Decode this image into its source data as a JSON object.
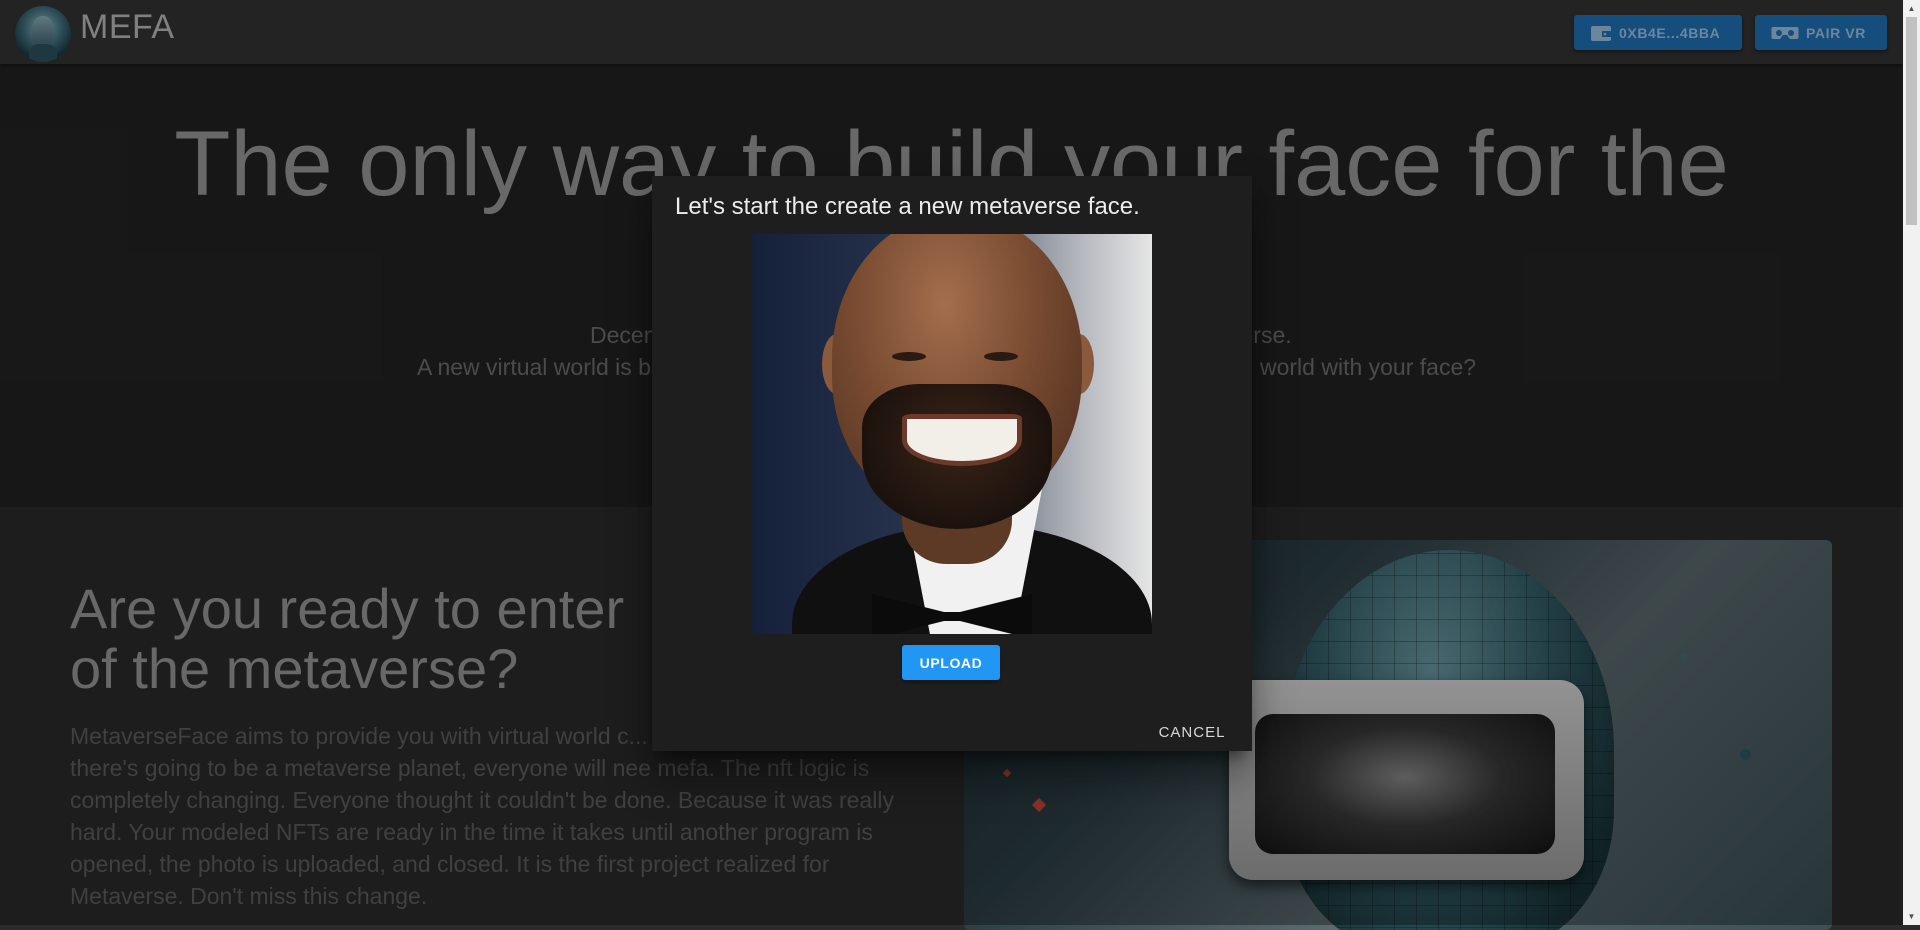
{
  "header": {
    "brand": "MEFA",
    "wallet_button": "0XB4E...4BBA",
    "pair_vr_button": "PAIR VR"
  },
  "hero": {
    "title": "The only way to build your face for the",
    "subtitle_line1_left": "Decen",
    "subtitle_line1_right": "verse.",
    "subtitle_line2_left": "A new virtual world is b",
    "subtitle_line2_right": "world with your face?"
  },
  "section": {
    "title_line1": "Are you ready to enter",
    "title_line2": "of the metaverse?",
    "paragraph": "MetaverseFace aims to provide you with virtual world c... with different features. If there's going to be a metaverse planet, everyone will nee mefa. The nft logic is completely changing. Everyone thought it couldn't be done. Because it was really hard. Your modeled NFTs are ready in the time it takes until another program is opened, the photo is uploaded, and closed. It is the first project realized for Metaverse. Don't miss this change."
  },
  "dialog": {
    "title": "Let's start the create a new metaverse face.",
    "upload_button": "UPLOAD",
    "cancel_button": "CANCEL"
  },
  "colors": {
    "appbar": "#343434",
    "hero_bg": "#232323",
    "accent_blue": "#2196f3",
    "dialog_bg": "#1e1e1e"
  },
  "icons": {
    "wallet": "wallet-icon",
    "vr": "vr-headset-icon"
  }
}
